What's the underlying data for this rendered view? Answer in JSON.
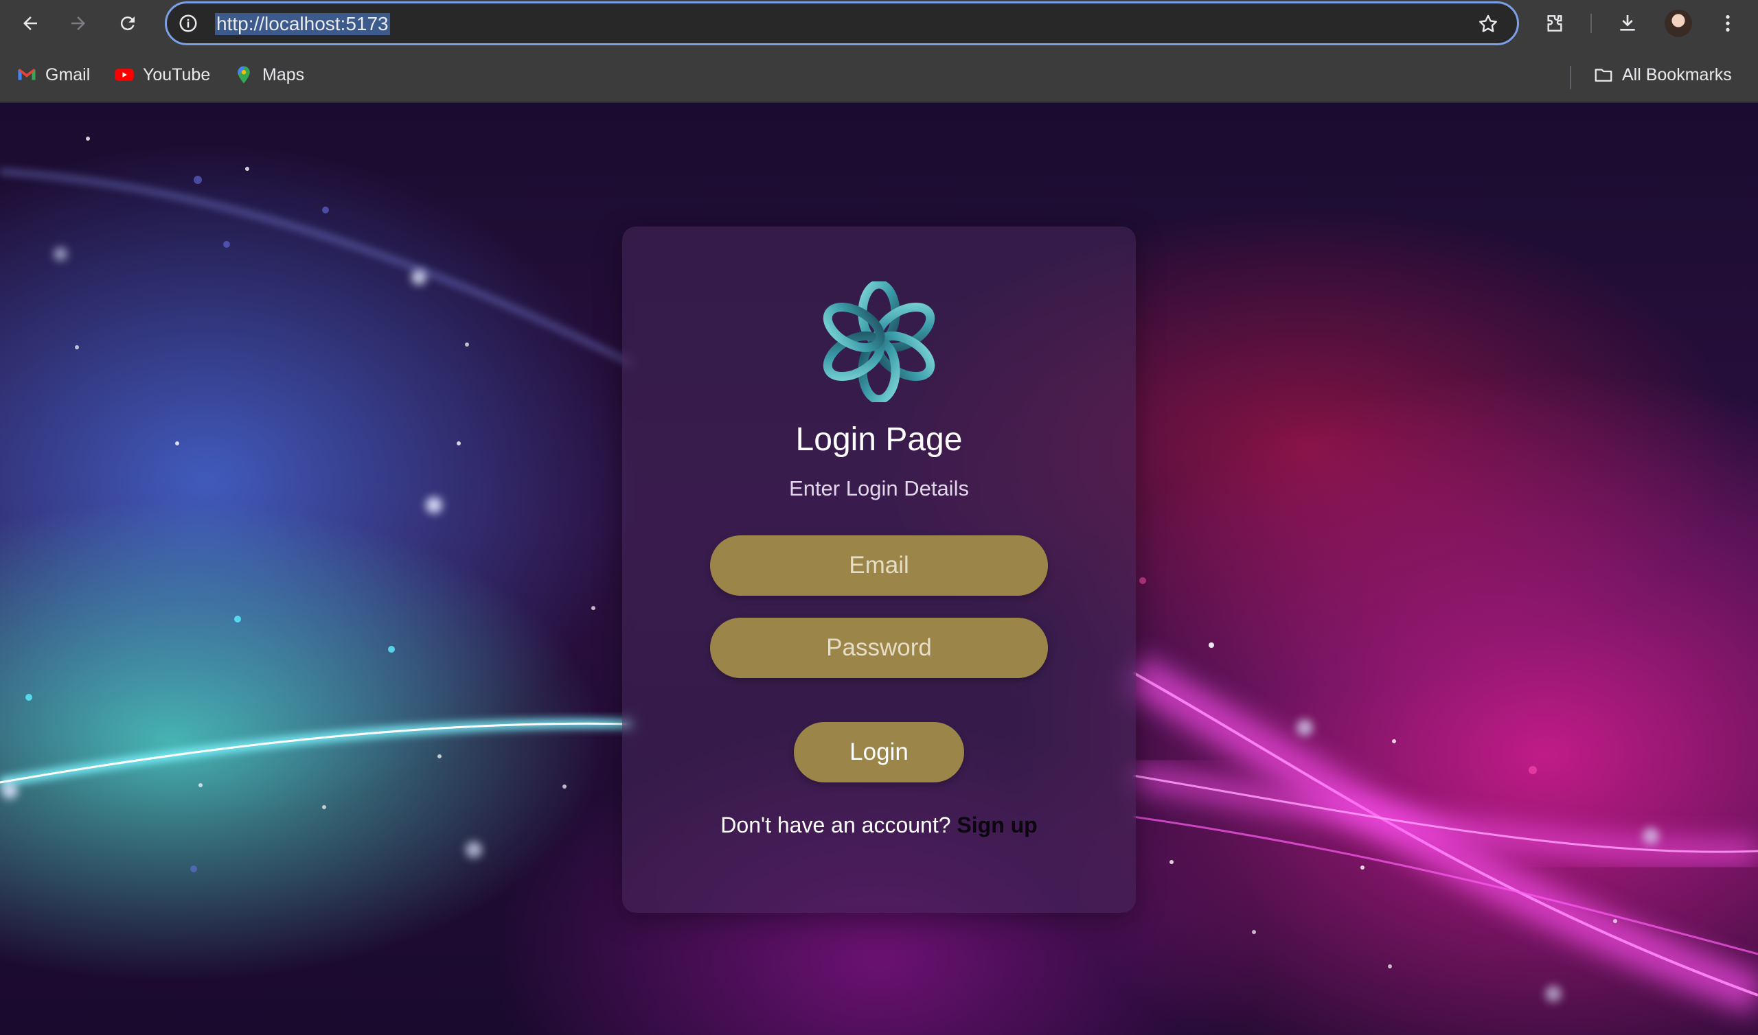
{
  "browser": {
    "url": "http://localhost:5173",
    "bookmarks": [
      {
        "label": "Gmail",
        "icon": "gmail-icon"
      },
      {
        "label": "YouTube",
        "icon": "youtube-icon"
      },
      {
        "label": "Maps",
        "icon": "maps-icon"
      }
    ],
    "all_bookmarks_label": "All Bookmarks"
  },
  "login": {
    "title": "Login Page",
    "subtitle": "Enter Login Details",
    "email_placeholder": "Email",
    "password_placeholder": "Password",
    "login_label": "Login",
    "signup_prompt": "Don't have an account?",
    "signup_link": "Sign up"
  },
  "colors": {
    "field_bg": "#9c8549",
    "card_bg": "rgba(70,40,90,0.55)",
    "omnibox_focus": "#7ca0e8"
  }
}
